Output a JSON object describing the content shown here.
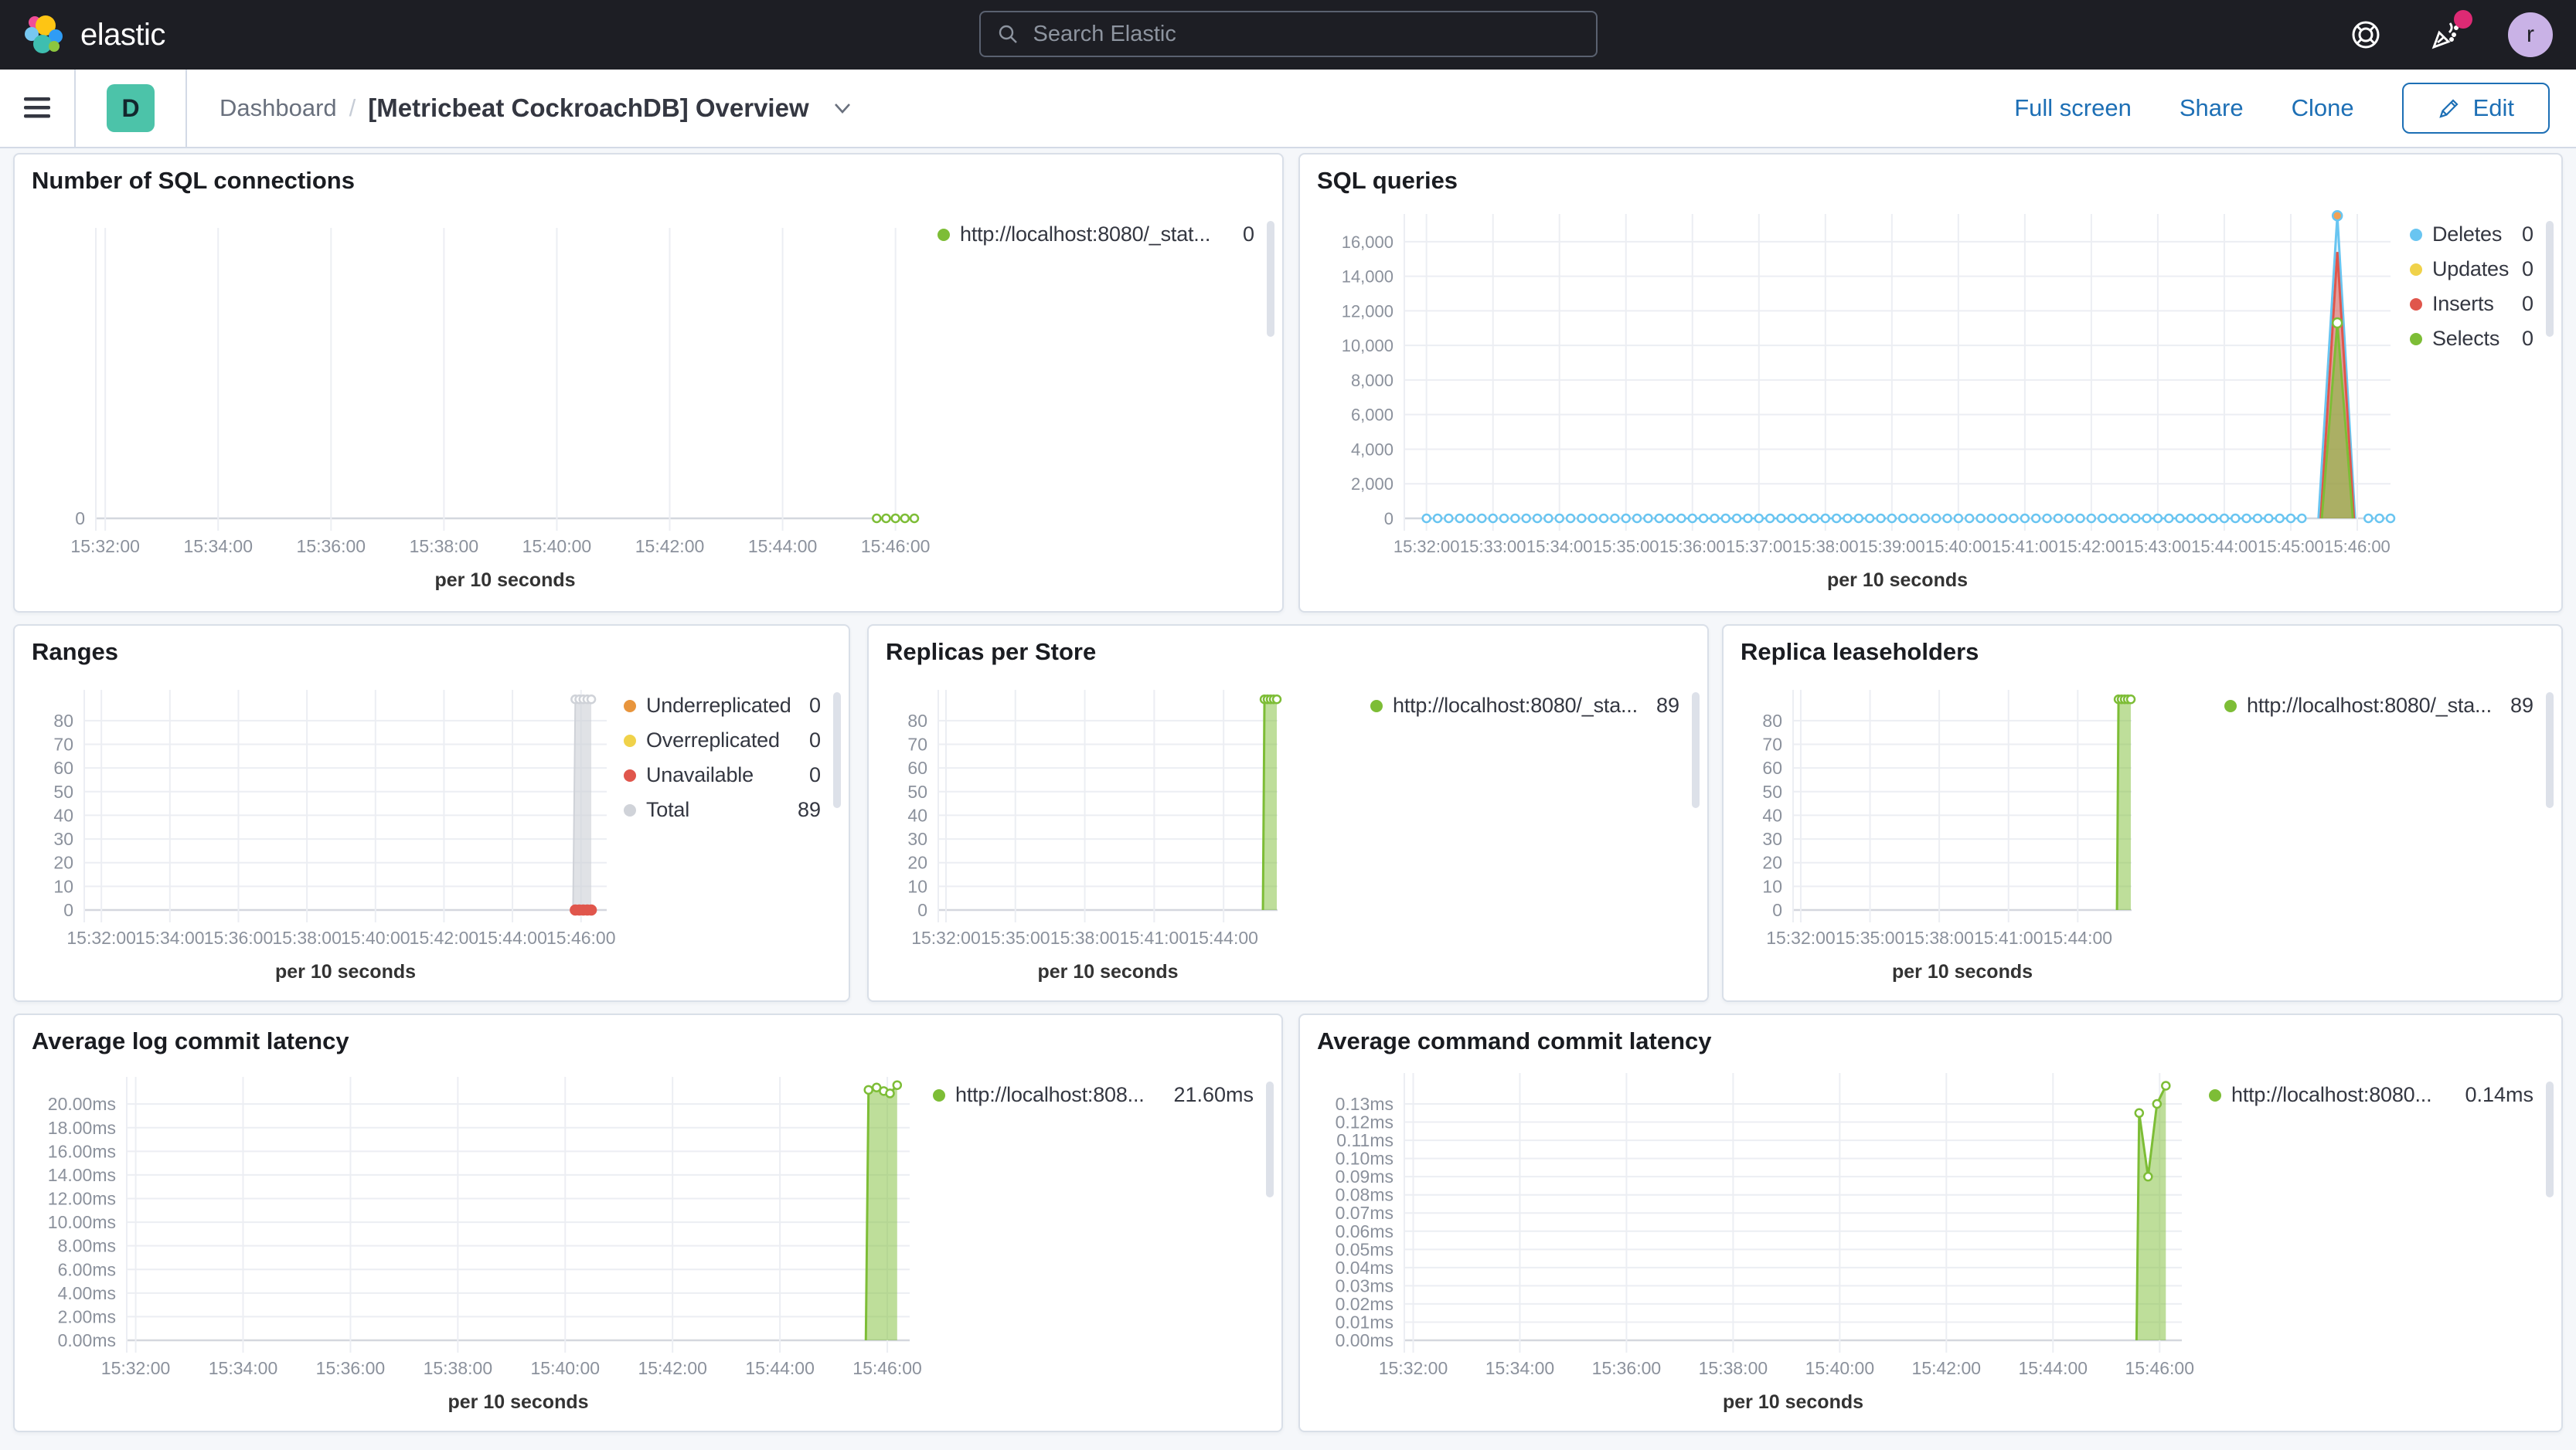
{
  "topbar": {
    "brand": "elastic",
    "search_placeholder": "Search Elastic",
    "avatar_initial": "r"
  },
  "header": {
    "space_badge": "D",
    "breadcrumb_root": "Dashboard",
    "breadcrumb_separator": "/",
    "title": "[Metricbeat CockroachDB] Overview",
    "actions": {
      "full_screen": "Full screen",
      "share": "Share",
      "clone": "Clone",
      "edit": "Edit"
    }
  },
  "colors": {
    "link_blue": "#1d6fb5",
    "series_green": "#7dbd36",
    "series_blue": "#69c5f1",
    "series_yellow": "#f0d24a",
    "series_red": "#e0564c",
    "series_orange": "#e8953d",
    "series_gray": "#d7dade",
    "badge_teal": "#4cc3a9",
    "notif_pink": "#dd2a74"
  },
  "panels": [
    {
      "id": "sql-connections",
      "title": "Number of SQL connections",
      "legend": [
        {
          "label": "http://localhost:8080/_stat...",
          "value": "0",
          "color": "#7dbd36"
        }
      ]
    },
    {
      "id": "sql-queries",
      "title": "SQL queries",
      "legend": [
        {
          "label": "Deletes",
          "value": "0",
          "color": "#69c5f1"
        },
        {
          "label": "Updates",
          "value": "0",
          "color": "#f0d24a"
        },
        {
          "label": "Inserts",
          "value": "0",
          "color": "#e0564c"
        },
        {
          "label": "Selects",
          "value": "0",
          "color": "#7dbd36"
        }
      ]
    },
    {
      "id": "ranges",
      "title": "Ranges",
      "legend": [
        {
          "label": "Underreplicated",
          "value": "0",
          "color": "#e8953d"
        },
        {
          "label": "Overreplicated",
          "value": "0",
          "color": "#f0d24a"
        },
        {
          "label": "Unavailable",
          "value": "0",
          "color": "#e0564c"
        },
        {
          "label": "Total",
          "value": "89",
          "color": "#d0d3d9"
        }
      ]
    },
    {
      "id": "replicas-per-store",
      "title": "Replicas per Store",
      "legend": [
        {
          "label": "http://localhost:8080/_sta...",
          "value": "89",
          "color": "#7dbd36"
        }
      ]
    },
    {
      "id": "replica-leaseholders",
      "title": "Replica leaseholders",
      "legend": [
        {
          "label": "http://localhost:8080/_sta...",
          "value": "89",
          "color": "#7dbd36"
        }
      ]
    },
    {
      "id": "avg-log-commit",
      "title": "Average log commit latency",
      "legend": [
        {
          "label": "http://localhost:808...",
          "value": "21.60ms",
          "color": "#7dbd36"
        }
      ]
    },
    {
      "id": "avg-cmd-commit",
      "title": "Average command commit latency",
      "legend": [
        {
          "label": "http://localhost:8080...",
          "value": "0.14ms",
          "color": "#7dbd36"
        }
      ]
    }
  ],
  "chart_data": [
    {
      "panel": "sql-connections",
      "type": "line",
      "title": "Number of SQL connections",
      "xlabel": "per 10 seconds",
      "x_domain": [
        "15:31:50",
        "15:46:20"
      ],
      "x_ticks": [
        "15:32:00",
        "15:34:00",
        "15:36:00",
        "15:38:00",
        "15:40:00",
        "15:42:00",
        "15:44:00",
        "15:46:00"
      ],
      "ylim": [
        0,
        8
      ],
      "y_ticks": [
        [
          0,
          "0"
        ]
      ],
      "margins": {
        "l": 95,
        "r": 30,
        "t": 40,
        "b": 108
      },
      "series": [
        {
          "name": "http://localhost:8080/_stat...",
          "color": "#7dbd36",
          "dashed": true,
          "width": 2.5,
          "markers": "all",
          "marker_r": 5,
          "points": [
            [
              "15:45:40",
              0
            ],
            [
              "15:45:50",
              0
            ],
            [
              "15:46:00",
              0
            ],
            [
              "15:46:10",
              0
            ],
            [
              "15:46:20",
              0
            ]
          ]
        }
      ]
    },
    {
      "panel": "sql-queries",
      "type": "area",
      "title": "SQL queries",
      "xlabel": "per 10 seconds",
      "x_domain": [
        "15:31:40",
        "15:46:30"
      ],
      "x_ticks": [
        "15:32:00",
        "15:33:00",
        "15:34:00",
        "15:35:00",
        "15:36:00",
        "15:37:00",
        "15:38:00",
        "15:39:00",
        "15:40:00",
        "15:41:00",
        "15:42:00",
        "15:43:00",
        "15:44:00",
        "15:45:00",
        "15:46:00"
      ],
      "ylim": [
        0,
        17600
      ],
      "y_ticks": [
        [
          0,
          "0"
        ],
        [
          2000,
          "2,000"
        ],
        [
          4000,
          "4,000"
        ],
        [
          6000,
          "6,000"
        ],
        [
          8000,
          "8,000"
        ],
        [
          10000,
          "10,000"
        ],
        [
          12000,
          "12,000"
        ],
        [
          14000,
          "14,000"
        ],
        [
          16000,
          "16,000"
        ]
      ],
      "tick_font": 22,
      "margins": {
        "l": 125,
        "r": 25,
        "t": 22,
        "b": 108
      },
      "series": [
        {
          "name": "Deletes",
          "color": "#69c5f1",
          "dashed": true,
          "width": 2.5,
          "markers": "all",
          "marker_r": 5,
          "span": {
            "from": "15:32:00",
            "to": "15:45:10",
            "step_s": 10,
            "value": 0
          }
        },
        {
          "name": "Deletes-spike",
          "color": "#69c5f1",
          "width": 3,
          "fill": true,
          "fill_opacity": 0.18,
          "markers": "peak",
          "peak_fill": "#f2a154",
          "points": [
            [
              "15:45:25",
              0
            ],
            [
              "15:45:42",
              17500
            ],
            [
              "15:45:58",
              0
            ]
          ]
        },
        {
          "name": "Deletes-after",
          "color": "#69c5f1",
          "dashed": true,
          "width": 2.5,
          "markers": "all",
          "marker_r": 5,
          "span": {
            "from": "15:46:10",
            "to": "15:46:30",
            "step_s": 10,
            "value": 0
          }
        },
        {
          "name": "Inserts",
          "color": "#e0564c",
          "width": 3,
          "fill": true,
          "fill_opacity": 0.55,
          "markers": "none",
          "points": [
            [
              "15:45:27",
              0
            ],
            [
              "15:45:42",
              15400
            ],
            [
              "15:45:57",
              0
            ]
          ]
        },
        {
          "name": "Selects",
          "color": "#7dbd36",
          "width": 3,
          "fill": true,
          "fill_opacity": 0.55,
          "markers": "peak",
          "peak_fill": "#ffffff",
          "points": [
            [
              "15:45:28",
              0
            ],
            [
              "15:45:42",
              11300
            ],
            [
              "15:45:56",
              0
            ]
          ]
        }
      ]
    },
    {
      "panel": "ranges",
      "type": "area",
      "title": "Ranges",
      "xlabel": "per 10 seconds",
      "x_domain": [
        "15:31:30",
        "15:46:45"
      ],
      "x_ticks": [
        "15:32:00",
        "15:34:00",
        "15:36:00",
        "15:38:00",
        "15:40:00",
        "15:42:00",
        "15:44:00",
        "15:46:00"
      ],
      "ylim": [
        0,
        93
      ],
      "y_ticks": [
        [
          0,
          "0"
        ],
        [
          10,
          "10"
        ],
        [
          20,
          "20"
        ],
        [
          30,
          "30"
        ],
        [
          40,
          "40"
        ],
        [
          50,
          "50"
        ],
        [
          60,
          "60"
        ],
        [
          70,
          "70"
        ],
        [
          80,
          "80"
        ]
      ],
      "margins": {
        "l": 80,
        "r": 22,
        "t": 28,
        "b": 105
      },
      "series": [
        {
          "name": "Total",
          "color": "#cfd2d8",
          "width": 2,
          "fill": true,
          "fill_opacity": 0.65,
          "markers": "skip-first",
          "marker_r": 5,
          "points": [
            [
              "15:45:46",
              0
            ],
            [
              "15:45:50",
              89
            ],
            [
              "15:45:57",
              89
            ],
            [
              "15:46:04",
              89
            ],
            [
              "15:46:11",
              89
            ],
            [
              "15:46:18",
              89
            ]
          ]
        },
        {
          "name": "Unavailable",
          "color": "#e0564c",
          "line": false,
          "markers": "all",
          "marker_solid": true,
          "marker_r": 6,
          "points": [
            [
              "15:45:50",
              0
            ],
            [
              "15:45:57",
              0
            ],
            [
              "15:46:04",
              0
            ],
            [
              "15:46:11",
              0
            ],
            [
              "15:46:18",
              0
            ]
          ]
        }
      ]
    },
    {
      "panel": "replicas-per-store",
      "type": "area",
      "title": "Replicas per Store",
      "xlabel": "per 10 seconds",
      "x_domain": [
        "15:31:40",
        "15:46:20"
      ],
      "x_ticks": [
        "15:32:00",
        "15:35:00",
        "15:38:00",
        "15:41:00",
        "15:44:00"
      ],
      "ylim": [
        0,
        93
      ],
      "y_ticks": [
        [
          0,
          "0"
        ],
        [
          10,
          "10"
        ],
        [
          20,
          "20"
        ],
        [
          30,
          "30"
        ],
        [
          40,
          "40"
        ],
        [
          50,
          "50"
        ],
        [
          60,
          "60"
        ],
        [
          70,
          "70"
        ],
        [
          80,
          "80"
        ]
      ],
      "margins": {
        "l": 80,
        "r": 120,
        "t": 28,
        "b": 105
      },
      "series": [
        {
          "name": "http://localhost:8080/_sta...",
          "color": "#7dbd36",
          "width": 3,
          "fill": true,
          "fill_opacity": 0.5,
          "markers": "skip-first",
          "marker_r": 5,
          "points": [
            [
              "15:45:42",
              0
            ],
            [
              "15:45:46",
              89
            ],
            [
              "15:45:54",
              89
            ],
            [
              "15:46:02",
              89
            ],
            [
              "15:46:10",
              89
            ],
            [
              "15:46:18",
              89
            ]
          ]
        }
      ]
    },
    {
      "panel": "replica-leaseholders",
      "type": "area",
      "title": "Replica leaseholders",
      "xlabel": "per 10 seconds",
      "x_domain": [
        "15:31:40",
        "15:46:20"
      ],
      "x_ticks": [
        "15:32:00",
        "15:35:00",
        "15:38:00",
        "15:41:00",
        "15:44:00"
      ],
      "ylim": [
        0,
        93
      ],
      "y_ticks": [
        [
          0,
          "0"
        ],
        [
          10,
          "10"
        ],
        [
          20,
          "20"
        ],
        [
          30,
          "30"
        ],
        [
          40,
          "40"
        ],
        [
          50,
          "50"
        ],
        [
          60,
          "60"
        ],
        [
          70,
          "70"
        ],
        [
          80,
          "80"
        ]
      ],
      "margins": {
        "l": 80,
        "r": 120,
        "t": 28,
        "b": 105
      },
      "series": [
        {
          "name": "http://localhost:8080/_sta...",
          "color": "#7dbd36",
          "width": 3,
          "fill": true,
          "fill_opacity": 0.5,
          "markers": "skip-first",
          "marker_r": 5,
          "points": [
            [
              "15:45:42",
              0
            ],
            [
              "15:45:46",
              89
            ],
            [
              "15:45:54",
              89
            ],
            [
              "15:46:02",
              89
            ],
            [
              "15:46:10",
              89
            ],
            [
              "15:46:18",
              89
            ]
          ]
        }
      ]
    },
    {
      "panel": "avg-log-commit",
      "type": "area",
      "title": "Average log commit latency",
      "xlabel": "per 10 seconds",
      "x_domain": [
        "15:31:50",
        "15:46:25"
      ],
      "x_ticks": [
        "15:32:00",
        "15:34:00",
        "15:36:00",
        "15:38:00",
        "15:40:00",
        "15:42:00",
        "15:44:00",
        "15:46:00"
      ],
      "ylim": [
        0,
        22.3
      ],
      "y_ticks": [
        [
          0,
          "0.00ms"
        ],
        [
          2,
          "2.00ms"
        ],
        [
          4,
          "4.00ms"
        ],
        [
          6,
          "6.00ms"
        ],
        [
          8,
          "8.00ms"
        ],
        [
          10,
          "10.00ms"
        ],
        [
          12,
          "12.00ms"
        ],
        [
          14,
          "14.00ms"
        ],
        [
          16,
          "16.00ms"
        ],
        [
          18,
          "18.00ms"
        ],
        [
          20,
          "20.00ms"
        ]
      ],
      "margins": {
        "l": 135,
        "r": 30,
        "t": 25,
        "b": 105
      },
      "series": [
        {
          "name": "http://localhost:808...",
          "color": "#7dbd36",
          "width": 3,
          "fill": true,
          "fill_opacity": 0.5,
          "markers": "skip-first",
          "marker_r": 5,
          "points": [
            [
              "15:45:36",
              0
            ],
            [
              "15:45:39",
              21.2
            ],
            [
              "15:45:48",
              21.4
            ],
            [
              "15:45:56",
              21.1
            ],
            [
              "15:46:03",
              20.9
            ],
            [
              "15:46:11",
              21.6
            ]
          ]
        }
      ]
    },
    {
      "panel": "avg-cmd-commit",
      "type": "area",
      "title": "Average command commit latency",
      "xlabel": "per 10 seconds",
      "x_domain": [
        "15:31:50",
        "15:46:25"
      ],
      "x_ticks": [
        "15:32:00",
        "15:34:00",
        "15:36:00",
        "15:38:00",
        "15:40:00",
        "15:42:00",
        "15:44:00",
        "15:46:00"
      ],
      "ylim": [
        0,
        0.147
      ],
      "y_ticks": [
        [
          0,
          "0.00ms"
        ],
        [
          0.01,
          "0.01ms"
        ],
        [
          0.02,
          "0.02ms"
        ],
        [
          0.03,
          "0.03ms"
        ],
        [
          0.04,
          "0.04ms"
        ],
        [
          0.05,
          "0.05ms"
        ],
        [
          0.06,
          "0.06ms"
        ],
        [
          0.07,
          "0.07ms"
        ],
        [
          0.08,
          "0.08ms"
        ],
        [
          0.09,
          "0.09ms"
        ],
        [
          0.1,
          "0.10ms"
        ],
        [
          0.11,
          "0.11ms"
        ],
        [
          0.12,
          "0.12ms"
        ],
        [
          0.13,
          "0.13ms"
        ]
      ],
      "margins": {
        "l": 125,
        "r": 35,
        "t": 20,
        "b": 105
      },
      "series": [
        {
          "name": "http://localhost:8080...",
          "color": "#7dbd36",
          "width": 3,
          "fill": true,
          "fill_opacity": 0.5,
          "markers": "skip-first",
          "marker_r": 5,
          "points": [
            [
              "15:45:34",
              0
            ],
            [
              "15:45:37",
              0.125
            ],
            [
              "15:45:47",
              0.09
            ],
            [
              "15:45:57",
              0.13
            ],
            [
              "15:46:07",
              0.14
            ]
          ]
        }
      ]
    }
  ],
  "layout_note_values": {
    "legend_widths": [
      440,
      190,
      285,
      430,
      430,
      445,
      450
    ],
    "panel_rects": [
      [
        17,
        198,
        1644,
        595
      ],
      [
        1680,
        198,
        1636,
        595
      ],
      [
        17,
        808,
        1083,
        489
      ],
      [
        1122,
        808,
        1089,
        489
      ],
      [
        2228,
        808,
        1088,
        489
      ],
      [
        17,
        1312,
        1643,
        542
      ],
      [
        1680,
        1312,
        1636,
        542
      ]
    ]
  }
}
